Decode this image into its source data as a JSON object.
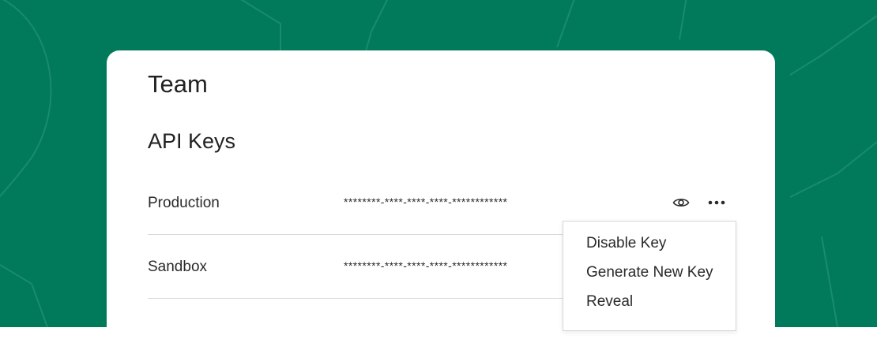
{
  "page": {
    "title": "Team",
    "section_title": "API Keys"
  },
  "api_keys": [
    {
      "name": "Production",
      "masked_value": "********-****-****-****-************"
    },
    {
      "name": "Sandbox",
      "masked_value": "********-****-****-****-************"
    }
  ],
  "context_menu": {
    "items": [
      "Disable Key",
      "Generate New Key",
      "Reveal"
    ]
  },
  "icons": {
    "reveal": "eye-icon",
    "more": "more-horizontal-icon"
  },
  "colors": {
    "background": "#017a5b",
    "card": "#ffffff",
    "divider": "#d8d8d8"
  }
}
